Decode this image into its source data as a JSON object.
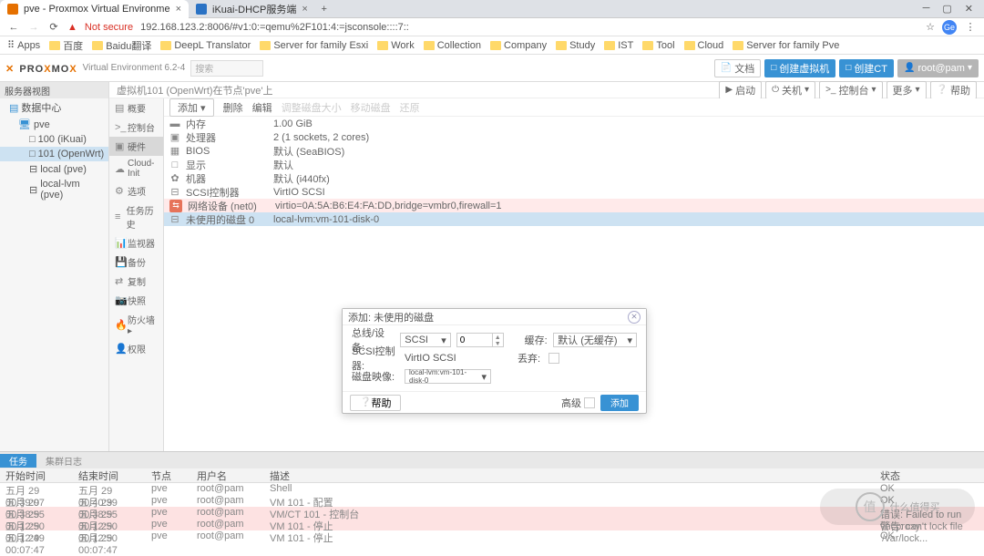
{
  "browser": {
    "tabs": [
      {
        "title": "pve - Proxmox Virtual Environme",
        "icon": "#e57000"
      },
      {
        "title": "iKuai-DHCP服务端",
        "icon": "#2a72c4"
      }
    ],
    "security": "Not secure",
    "url": "192.168.123.2:8006/#v1:0:=qemu%2F101:4:=jsconsole::::7::",
    "bookmarks": [
      "Apps",
      "百度",
      "Baidu翻译",
      "DeepL Translator",
      "Server for family Esxi",
      "Work",
      "Collection",
      "Company",
      "Study",
      "IST",
      "Tool",
      "Cloud",
      "Server for family Pve"
    ]
  },
  "pve": {
    "logo_env": "Virtual Environment 6.2-4",
    "search_ph": "搜索",
    "top_btns": {
      "doc": "文档",
      "vm": "创建虚拟机",
      "ct": "创建CT",
      "user": "root@pam"
    },
    "tree": {
      "header": "服务器视图",
      "dc": "数据中心",
      "node": "pve",
      "vm100": "100 (iKuai)",
      "vm101": "101 (OpenWrt)",
      "local": "local (pve)",
      "locallvm": "local-lvm (pve)"
    },
    "crumb": "虚拟机101 (OpenWrt)在节点'pve'上",
    "crumb_btns": {
      "start": "启动",
      "shut": "关机",
      "console": "控制台",
      "more": "更多",
      "help": "帮助"
    },
    "sidemenu": [
      "概要",
      "控制台",
      "硬件",
      "Cloud-Init",
      "选项",
      "任务历史",
      "监视器",
      "备份",
      "复制",
      "快照",
      "防火墙",
      "权限"
    ],
    "sidemenu_sel": 2,
    "toolbar": {
      "add": "添加",
      "del": "删除",
      "edit": "编辑",
      "resize": "调整磁盘大小",
      "move": "移动磁盘",
      "revert": "还原"
    },
    "hw": [
      {
        "icon": "▬",
        "k": "内存",
        "v": "1.00 GiB"
      },
      {
        "icon": "▣",
        "k": "处理器",
        "v": "2 (1 sockets, 2 cores)"
      },
      {
        "icon": "▦",
        "k": "BIOS",
        "v": "默认 (SeaBIOS)"
      },
      {
        "icon": "□",
        "k": "显示",
        "v": "默认"
      },
      {
        "icon": "✿",
        "k": "机器",
        "v": "默认 (i440fx)"
      },
      {
        "icon": "⊟",
        "k": "SCSI控制器",
        "v": "VirtIO SCSI"
      },
      {
        "icon": "red",
        "k": "网络设备 (net0)",
        "v": "virtio=0A:5A:B6:E4:FA:DD,bridge=vmbr0,firewall=1"
      },
      {
        "icon": "⊟",
        "k": "未使用的磁盘 0",
        "v": "local-lvm:vm-101-disk-0",
        "sel": true
      }
    ]
  },
  "dialog": {
    "title": "添加: 未使用的磁盘",
    "bus_lab": "总线/设备:",
    "bus_val": "SCSI",
    "bus_idx": "0",
    "cache_lab": "缓存:",
    "cache_val": "默认 (无缓存)",
    "ctrl_lab": "SCSI控制器:",
    "ctrl_val": "VirtIO SCSI",
    "discard_lab": "丢弃:",
    "img_lab": "磁盘映像:",
    "img_val": "local-lvm:vm-101-disk-0",
    "help": "帮助",
    "adv": "高级",
    "ok": "添加"
  },
  "log": {
    "tabs": [
      "任务",
      "集群日志"
    ],
    "headers": [
      "开始时间",
      "结束时间",
      "节点",
      "用户名",
      "描述",
      "状态"
    ],
    "rows": [
      {
        "t1": "五月 29 00:39:07",
        "t2": "五月 29 00:40:39",
        "n": "pve",
        "u": "root@pam",
        "d": "Shell",
        "s": "OK"
      },
      {
        "t1": "五月 29 00:38:55",
        "t2": "五月 29 00:38:55",
        "n": "pve",
        "u": "root@pam",
        "d": "VM 101 - 配置",
        "s": "OK"
      },
      {
        "t1": "五月 29 00:12:50",
        "t2": "五月 29 00:12:50",
        "n": "pve",
        "u": "root@pam",
        "d": "VM/CT 101 - 控制台",
        "s": "错误: Failed to run vncproxy.",
        "err": true
      },
      {
        "t1": "五月 29 00:12:49",
        "t2": "五月 29 00:12:50",
        "n": "pve",
        "u": "root@pam",
        "d": "VM 101 - 停止",
        "s": "警告: can't lock file '/var/lock...",
        "err": true
      },
      {
        "t1": "五月 29 00:07:47",
        "t2": "五月 29 00:07:47",
        "n": "pve",
        "u": "root@pam",
        "d": "VM 101 - 停止",
        "s": "OK"
      }
    ]
  },
  "watermark": "什么值得买"
}
